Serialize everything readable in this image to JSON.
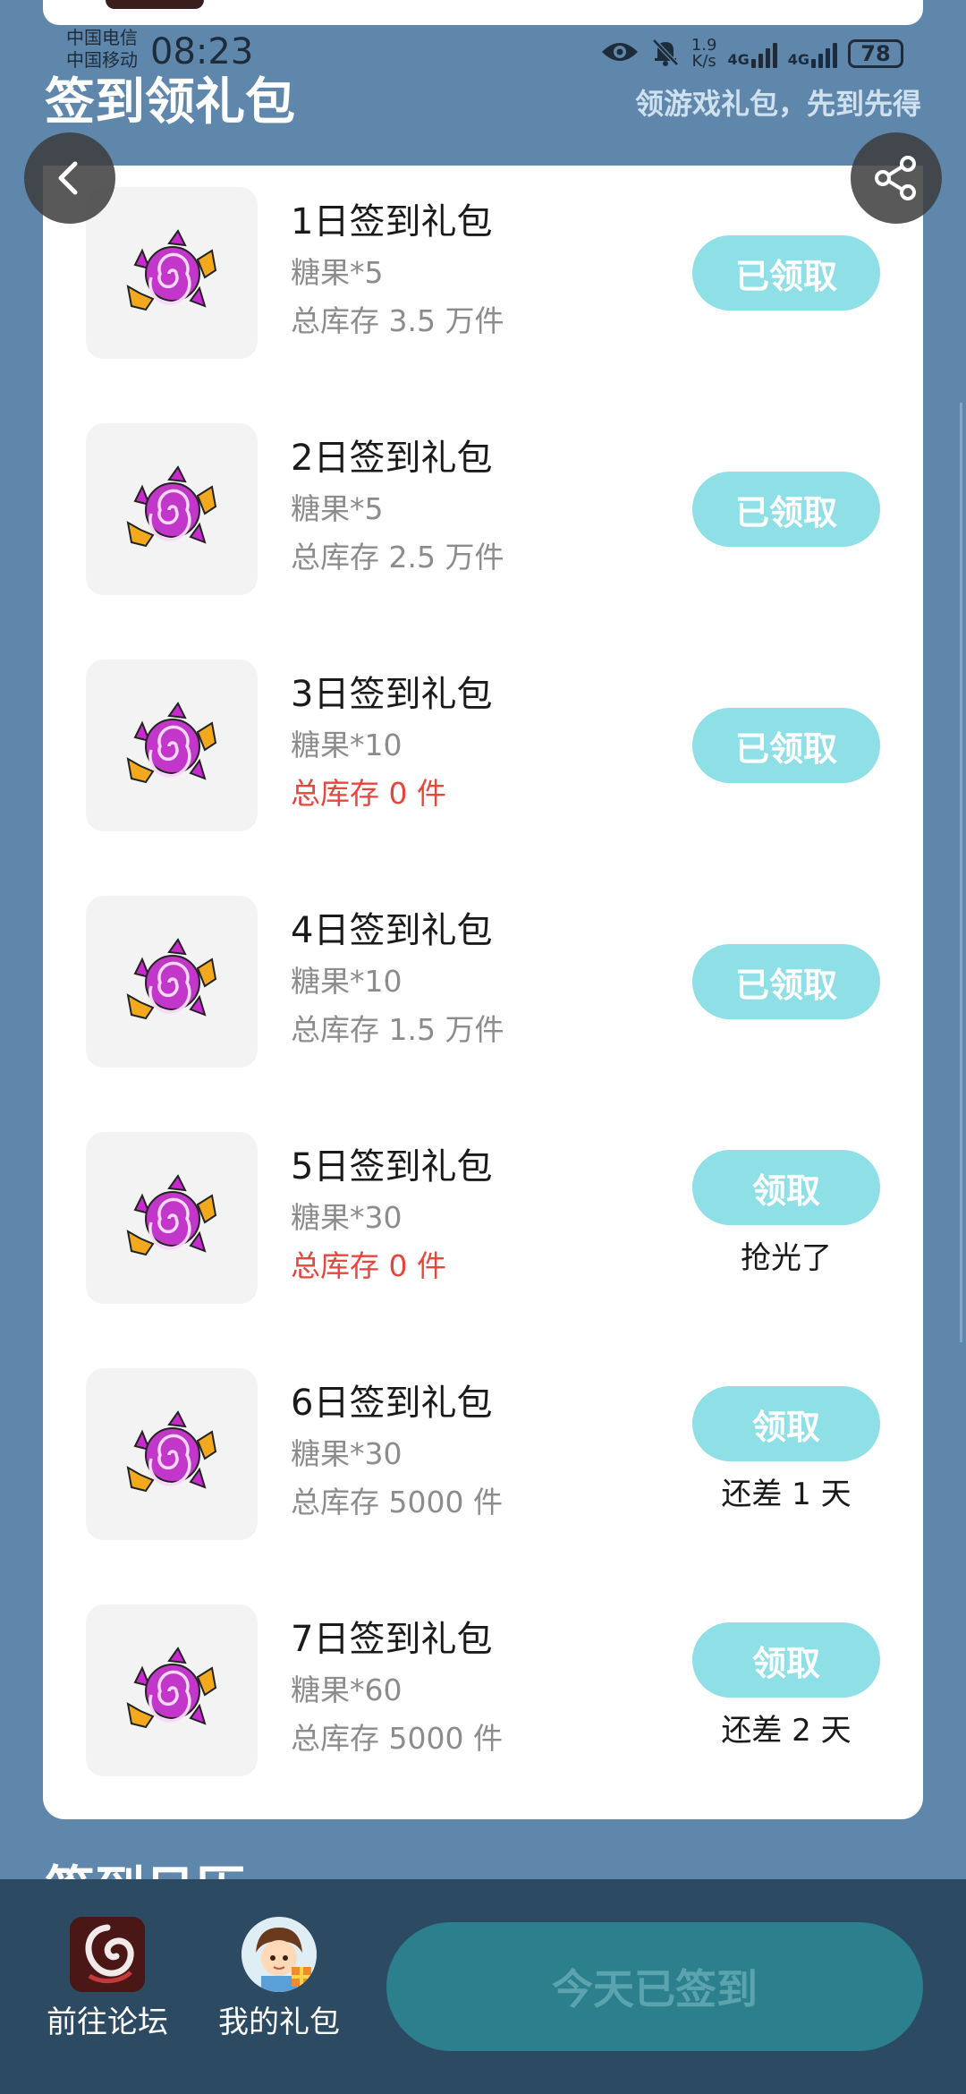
{
  "status_bar": {
    "carrier_1": "中国电信",
    "carrier_2": "中国移动",
    "time": "08:23",
    "net_speed_value": "1.9",
    "net_speed_unit": "K/s",
    "network_1": "4G",
    "network_2": "4G",
    "battery": "78"
  },
  "header": {
    "title": "签到领礼包",
    "subtitle": "领游戏礼包，先到先得"
  },
  "rewards": [
    {
      "title": "1日签到礼包",
      "desc": "糖果*5",
      "stock": "总库存 3.5 万件",
      "stock_empty": false,
      "button": "已领取",
      "note": ""
    },
    {
      "title": "2日签到礼包",
      "desc": "糖果*5",
      "stock": "总库存 2.5 万件",
      "stock_empty": false,
      "button": "已领取",
      "note": ""
    },
    {
      "title": "3日签到礼包",
      "desc": "糖果*10",
      "stock": "总库存 0 件",
      "stock_empty": true,
      "button": "已领取",
      "note": ""
    },
    {
      "title": "4日签到礼包",
      "desc": "糖果*10",
      "stock": "总库存 1.5 万件",
      "stock_empty": false,
      "button": "已领取",
      "note": ""
    },
    {
      "title": "5日签到礼包",
      "desc": "糖果*30",
      "stock": "总库存 0 件",
      "stock_empty": true,
      "button": "领取",
      "note": "抢光了"
    },
    {
      "title": "6日签到礼包",
      "desc": "糖果*30",
      "stock": "总库存 5000 件",
      "stock_empty": false,
      "button": "领取",
      "note": "还差 1 天"
    },
    {
      "title": "7日签到礼包",
      "desc": "糖果*60",
      "stock": "总库存 5000 件",
      "stock_empty": false,
      "button": "领取",
      "note": "还差 2 天"
    }
  ],
  "section_peek": "签到日历",
  "bottom_bar": {
    "forum_label": "前往论坛",
    "gifts_label": "我的礼包",
    "checkin_label": "今天已签到"
  },
  "colors": {
    "background": "#5f86ab",
    "claim_button": "#8ee0e6",
    "stock_empty": "#e8453c",
    "bottom_bar": "#2d4a63",
    "checkin_button": "#2c7f8c"
  }
}
